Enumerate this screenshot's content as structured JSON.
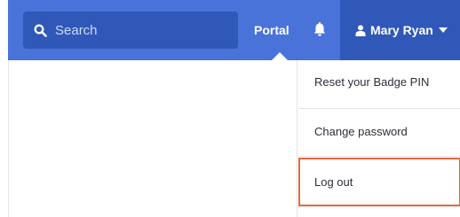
{
  "header": {
    "search": {
      "placeholder": "Search",
      "icon": "search-icon"
    },
    "portal_link": "Portal",
    "notifications_icon": "bell-icon",
    "user_menu": {
      "name": "Mary Ryan",
      "icon": "user-icon",
      "caret_icon": "caret-down-icon"
    }
  },
  "dropdown": {
    "items": [
      {
        "label": "Reset your Badge PIN"
      },
      {
        "label": "Change password"
      },
      {
        "label": "Log out",
        "highlighted": true
      }
    ]
  },
  "colors": {
    "navbar": "#4a73d9",
    "navbar_dark": "#2f58b8",
    "highlight_border": "#e0683f",
    "text": "#2b2f36"
  }
}
